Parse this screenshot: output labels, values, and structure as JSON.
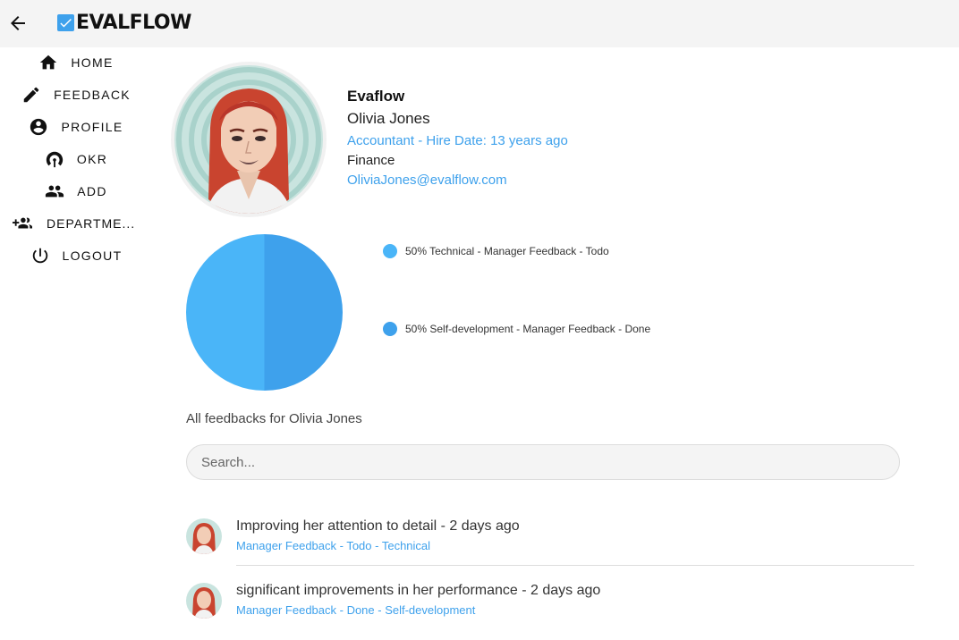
{
  "header": {
    "brand": "EVALFLOW"
  },
  "sidebar": {
    "items": [
      {
        "label": "HOME",
        "icon": "home-icon"
      },
      {
        "label": "FEEDBACK",
        "icon": "pencil-icon"
      },
      {
        "label": "PROFILE",
        "icon": "account-circle-icon"
      },
      {
        "label": "OKR",
        "icon": "target-icon"
      },
      {
        "label": "ADD",
        "icon": "people-icon"
      },
      {
        "label": "DEPARTME...",
        "icon": "group-add-icon"
      },
      {
        "label": "LOGOUT",
        "icon": "power-icon"
      }
    ]
  },
  "profile": {
    "company": "Evaflow",
    "name": "Olivia Jones",
    "role_line": "Accountant - Hire Date: 13 years ago",
    "department": "Finance",
    "email": "OliviaJones@evalflow.com"
  },
  "chart_data": {
    "type": "pie",
    "categories": [
      "Technical - Manager Feedback - Todo",
      "Self-development - Manager Feedback - Done"
    ],
    "values": [
      50,
      50
    ],
    "legend": [
      "50% Technical - Manager Feedback - Todo",
      "50% Self-development - Manager Feedback - Done"
    ],
    "colors": [
      "#4ab5f8",
      "#3ea1ec"
    ]
  },
  "feedbacks": {
    "title": "All feedbacks for Olivia Jones",
    "search_placeholder": "Search...",
    "items": [
      {
        "title": "Improving her attention to detail - 2 days ago",
        "subtitle": "Manager Feedback - Todo - Technical"
      },
      {
        "title": "significant improvements in her performance - 2 days ago",
        "subtitle": "Manager Feedback - Done - Self-development"
      }
    ]
  },
  "colors": {
    "accent": "#3ea1ec",
    "topbar": "#f4f4f4"
  }
}
